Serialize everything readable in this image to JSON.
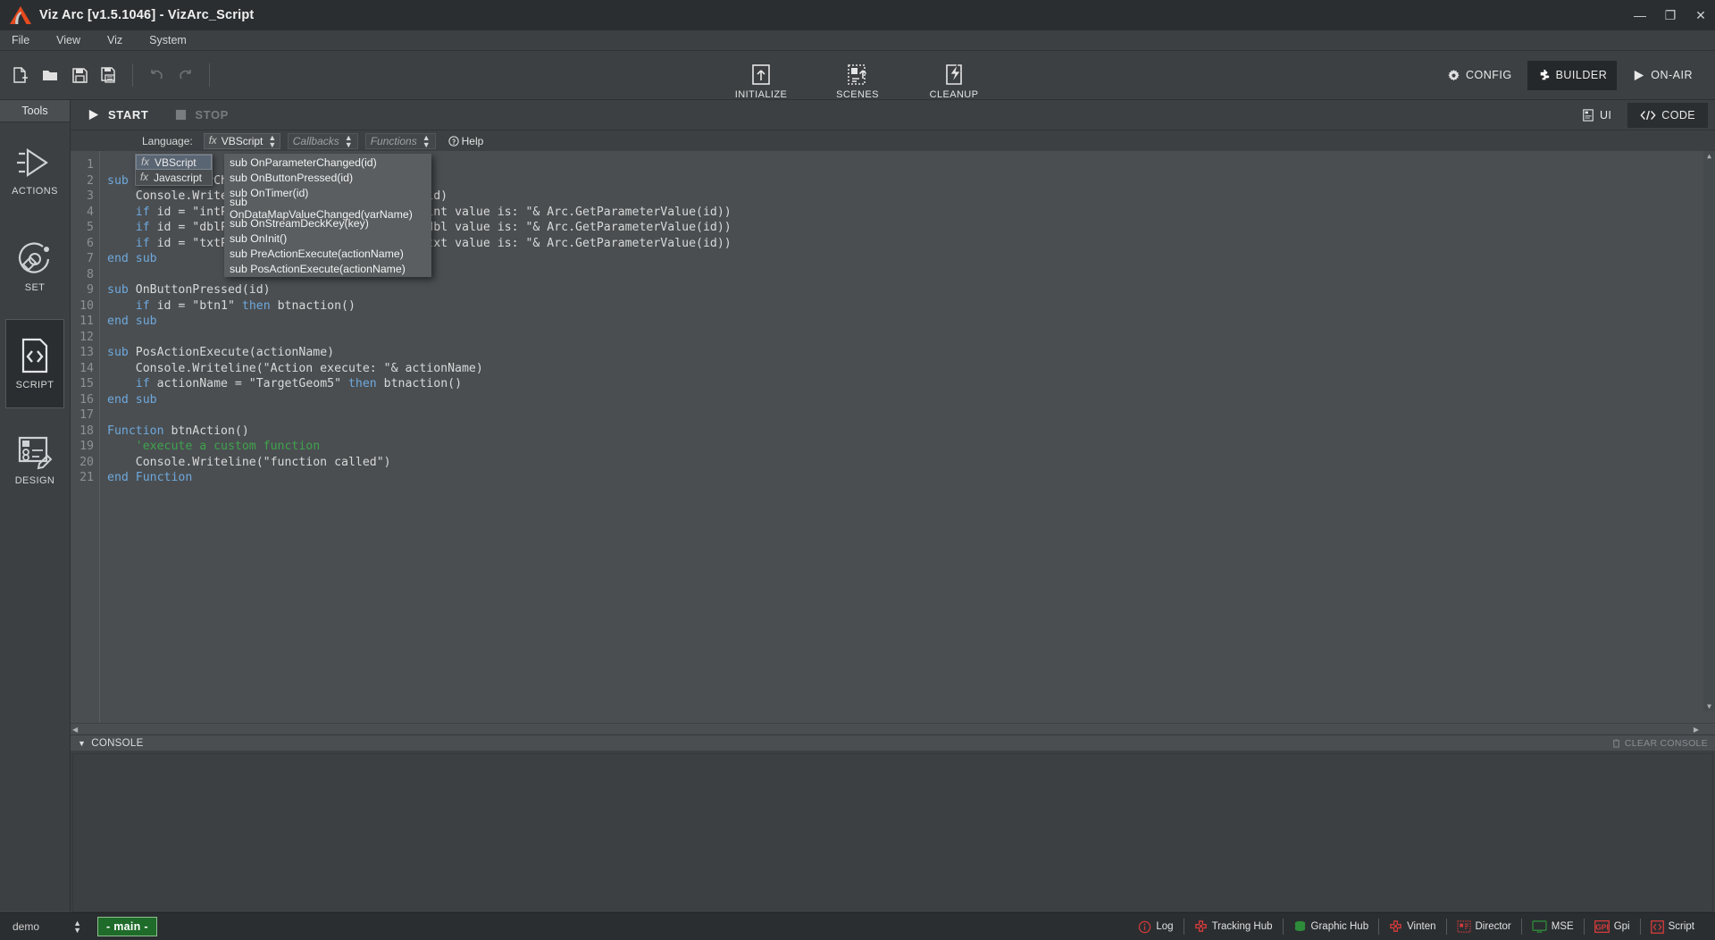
{
  "window": {
    "title": "Viz Arc [v1.5.1046] - VizArc_Script",
    "logo_icon": "viz-arc-logo-icon",
    "minimize": "—",
    "maximize": "❐",
    "close": "✕"
  },
  "menubar": {
    "items": [
      {
        "label": "File"
      },
      {
        "label": "View"
      },
      {
        "label": "Viz"
      },
      {
        "label": "System"
      }
    ]
  },
  "toolbar": {
    "left_icons": [
      {
        "name": "new-file-icon",
        "label": "New"
      },
      {
        "name": "open-folder-icon",
        "label": "Open"
      },
      {
        "name": "save-icon",
        "label": "Save"
      },
      {
        "name": "save-as-icon",
        "label": "Save As"
      },
      {
        "name": "undo-icon",
        "label": "Undo"
      },
      {
        "name": "redo-icon",
        "label": "Redo"
      }
    ],
    "center_buttons": [
      {
        "name": "initialize-button",
        "label": "INITIALIZE",
        "icon": "initialize-icon"
      },
      {
        "name": "scenes-button",
        "label": "SCENES",
        "icon": "scenes-icon"
      },
      {
        "name": "cleanup-button",
        "label": "CLEANUP",
        "icon": "cleanup-icon"
      }
    ],
    "modes": [
      {
        "name": "config-mode",
        "label": "CONFIG",
        "icon": "gear-icon",
        "active": false
      },
      {
        "name": "builder-mode",
        "label": "BUILDER",
        "icon": "puzzle-icon",
        "active": true
      },
      {
        "name": "on-air-mode",
        "label": "ON-AIR",
        "icon": "play-icon",
        "active": false
      }
    ]
  },
  "sidebar": {
    "title": "Tools",
    "items": [
      {
        "label": "ACTIONS",
        "icon": "actions-icon",
        "active": false
      },
      {
        "label": "SET",
        "icon": "set-icon",
        "active": false
      },
      {
        "label": "SCRIPT",
        "icon": "script-icon",
        "active": true
      },
      {
        "label": "DESIGN",
        "icon": "design-icon",
        "active": false
      }
    ]
  },
  "runbar": {
    "start_label": "START",
    "stop_label": "STOP",
    "start_icon": "play-icon",
    "stop_icon": "stop-icon",
    "views": [
      {
        "label": "UI",
        "icon": "ui-icon",
        "active": false
      },
      {
        "label": "CODE",
        "icon": "code-icon",
        "active": true
      }
    ]
  },
  "langbar": {
    "language_label": "Language:",
    "language_value": "VBScript",
    "language_prefix": "fx",
    "callbacks_label": "Callbacks",
    "functions_label": "Functions",
    "help_label": "Help",
    "help_icon": "question-icon"
  },
  "language_dropdown": {
    "options": [
      {
        "label": "VBScript",
        "prefix": "fx",
        "selected": true
      },
      {
        "label": "Javascript",
        "prefix": "fx",
        "selected": false
      }
    ]
  },
  "callbacks_dropdown": {
    "options": [
      {
        "label": "sub OnParameterChanged(id)"
      },
      {
        "label": "sub OnButtonPressed(id)"
      },
      {
        "label": "sub OnTimer(id)"
      },
      {
        "label": "sub OnDataMapValueChanged(varName)"
      },
      {
        "label": "sub OnStreamDeckKey(key)"
      },
      {
        "label": "sub OnInit()"
      },
      {
        "label": "sub PreActionExecute(actionName)"
      },
      {
        "label": "sub PosActionExecute(actionName)"
      }
    ]
  },
  "editor": {
    "line_numbers": [
      1,
      2,
      3,
      4,
      5,
      6,
      7,
      8,
      9,
      10,
      11,
      12,
      13,
      14,
      15,
      16,
      17,
      18,
      19,
      20,
      21
    ],
    "lines": [
      {
        "n": 1,
        "tokens": []
      },
      {
        "n": 2,
        "tokens": [
          {
            "t": "kw",
            "v": "sub "
          },
          {
            "t": "txt",
            "v": "OnParameterChanged(id)"
          }
        ]
      },
      {
        "n": 3,
        "tokens": [
          {
            "t": "txt",
            "v": "    Console.Writeline(\"parameter changed: \"& id)"
          }
        ]
      },
      {
        "n": 4,
        "tokens": [
          {
            "t": "txt",
            "v": "    "
          },
          {
            "t": "kw",
            "v": "if "
          },
          {
            "t": "txt",
            "v": "id = \"intPar\" "
          },
          {
            "t": "kw",
            "v": "then "
          },
          {
            "t": "txt",
            "v": "Console.Writeline(\"int value is: \"& Arc.GetParameterValue(id))"
          }
        ]
      },
      {
        "n": 5,
        "tokens": [
          {
            "t": "txt",
            "v": "    "
          },
          {
            "t": "kw",
            "v": "if "
          },
          {
            "t": "txt",
            "v": "id = \"dblPar\" "
          },
          {
            "t": "kw",
            "v": "then "
          },
          {
            "t": "txt",
            "v": "Console.Writeline(\"dbl value is: \"& Arc.GetParameterValue(id))"
          }
        ]
      },
      {
        "n": 6,
        "tokens": [
          {
            "t": "txt",
            "v": "    "
          },
          {
            "t": "kw",
            "v": "if "
          },
          {
            "t": "txt",
            "v": "id = \"txtPar\" "
          },
          {
            "t": "kw",
            "v": "then "
          },
          {
            "t": "txt",
            "v": "Console.Writeline(\"txt value is: \"& Arc.GetParameterValue(id))"
          }
        ]
      },
      {
        "n": 7,
        "tokens": [
          {
            "t": "kw",
            "v": "end sub"
          }
        ]
      },
      {
        "n": 8,
        "tokens": []
      },
      {
        "n": 9,
        "tokens": [
          {
            "t": "kw",
            "v": "sub "
          },
          {
            "t": "txt",
            "v": "OnButtonPressed(id)"
          }
        ]
      },
      {
        "n": 10,
        "tokens": [
          {
            "t": "txt",
            "v": "    "
          },
          {
            "t": "kw",
            "v": "if "
          },
          {
            "t": "txt",
            "v": "id = \"btn1\" "
          },
          {
            "t": "kw",
            "v": "then "
          },
          {
            "t": "txt",
            "v": "btnaction()"
          }
        ]
      },
      {
        "n": 11,
        "tokens": [
          {
            "t": "kw",
            "v": "end sub"
          }
        ]
      },
      {
        "n": 12,
        "tokens": []
      },
      {
        "n": 13,
        "tokens": [
          {
            "t": "kw",
            "v": "sub "
          },
          {
            "t": "txt",
            "v": "PosActionExecute(actionName)"
          }
        ]
      },
      {
        "n": 14,
        "tokens": [
          {
            "t": "txt",
            "v": "    Console.Writeline(\"Action execute: \"& actionName)"
          }
        ]
      },
      {
        "n": 15,
        "tokens": [
          {
            "t": "txt",
            "v": "    "
          },
          {
            "t": "kw",
            "v": "if "
          },
          {
            "t": "txt",
            "v": "actionName = \"TargetGeom5\" "
          },
          {
            "t": "kw",
            "v": "then "
          },
          {
            "t": "txt",
            "v": "btnaction()"
          }
        ]
      },
      {
        "n": 16,
        "tokens": [
          {
            "t": "kw",
            "v": "end sub"
          }
        ]
      },
      {
        "n": 17,
        "tokens": []
      },
      {
        "n": 18,
        "tokens": [
          {
            "t": "kw",
            "v": "Function "
          },
          {
            "t": "txt",
            "v": "btnAction()"
          }
        ]
      },
      {
        "n": 19,
        "tokens": [
          {
            "t": "cmt",
            "v": "    'execute a custom function"
          }
        ]
      },
      {
        "n": 20,
        "tokens": [
          {
            "t": "txt",
            "v": "    Console.Writeline(\"function called\")"
          }
        ]
      },
      {
        "n": 21,
        "tokens": [
          {
            "t": "kw",
            "v": "end "
          },
          {
            "t": "kw",
            "v": "Function"
          }
        ]
      }
    ]
  },
  "console": {
    "title": "CONSOLE",
    "caret": "▼",
    "clear_label": "CLEAR CONSOLE",
    "clear_icon": "trash-icon",
    "content": ""
  },
  "statusbar": {
    "profile": "demo",
    "branch": "- main -",
    "items": [
      {
        "label": "Log",
        "icon": "info-circle-icon",
        "color": "#d43b3b"
      },
      {
        "label": "Tracking Hub",
        "icon": "tracking-hub-icon",
        "color": "#d43b3b"
      },
      {
        "label": "Graphic Hub",
        "icon": "database-icon",
        "color": "#2e8b3a"
      },
      {
        "label": "Vinten",
        "icon": "vinten-icon",
        "color": "#d43b3b"
      },
      {
        "label": "Director",
        "icon": "director-icon",
        "color": "#d43b3b"
      },
      {
        "label": "MSE",
        "icon": "monitor-icon",
        "color": "#2e8b3a"
      },
      {
        "label": "Gpi",
        "icon": "gpi-icon",
        "color": "#d43b3b"
      },
      {
        "label": "Script",
        "icon": "script-status-icon",
        "color": "#d43b3b"
      }
    ]
  },
  "colors": {
    "accent_orange": "#e8491f",
    "keyword_blue": "#6fa8dc",
    "comment_green": "#3fa34d",
    "branch_green": "#1f6b2a"
  }
}
